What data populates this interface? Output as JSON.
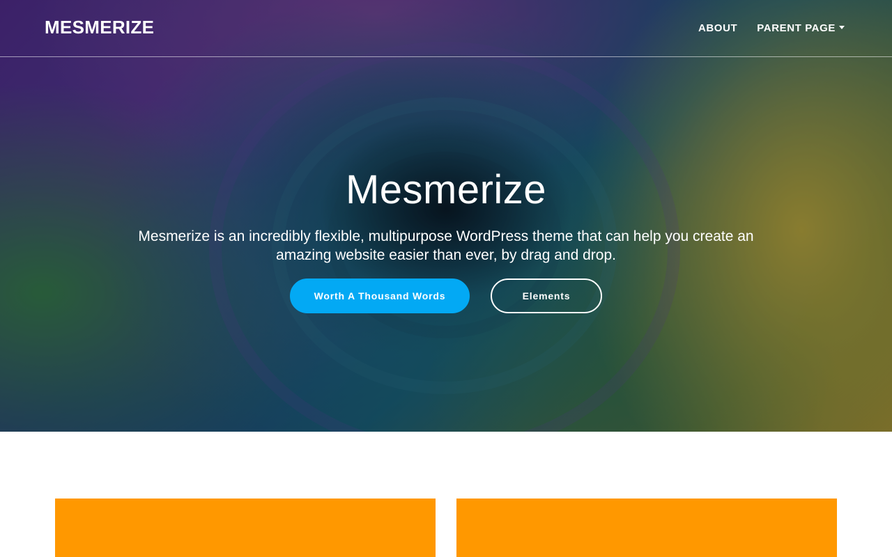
{
  "header": {
    "logo": "MESMERIZE",
    "nav": [
      {
        "label": "ABOUT"
      },
      {
        "label": "PARENT PAGE",
        "has_dropdown": true
      }
    ]
  },
  "hero": {
    "title": "Mesmerize",
    "subtitle": "Mesmerize is an incredibly flexible, multipurpose WordPress theme that can help you create an amazing website easier than ever, by drag and drop.",
    "buttons": {
      "primary": "Worth A Thousand Words",
      "secondary": "Elements"
    },
    "colors": {
      "primary_button": "#03a9f4",
      "outline_button": "#ffffff"
    }
  },
  "content": {
    "card_color": "#ff9800"
  }
}
